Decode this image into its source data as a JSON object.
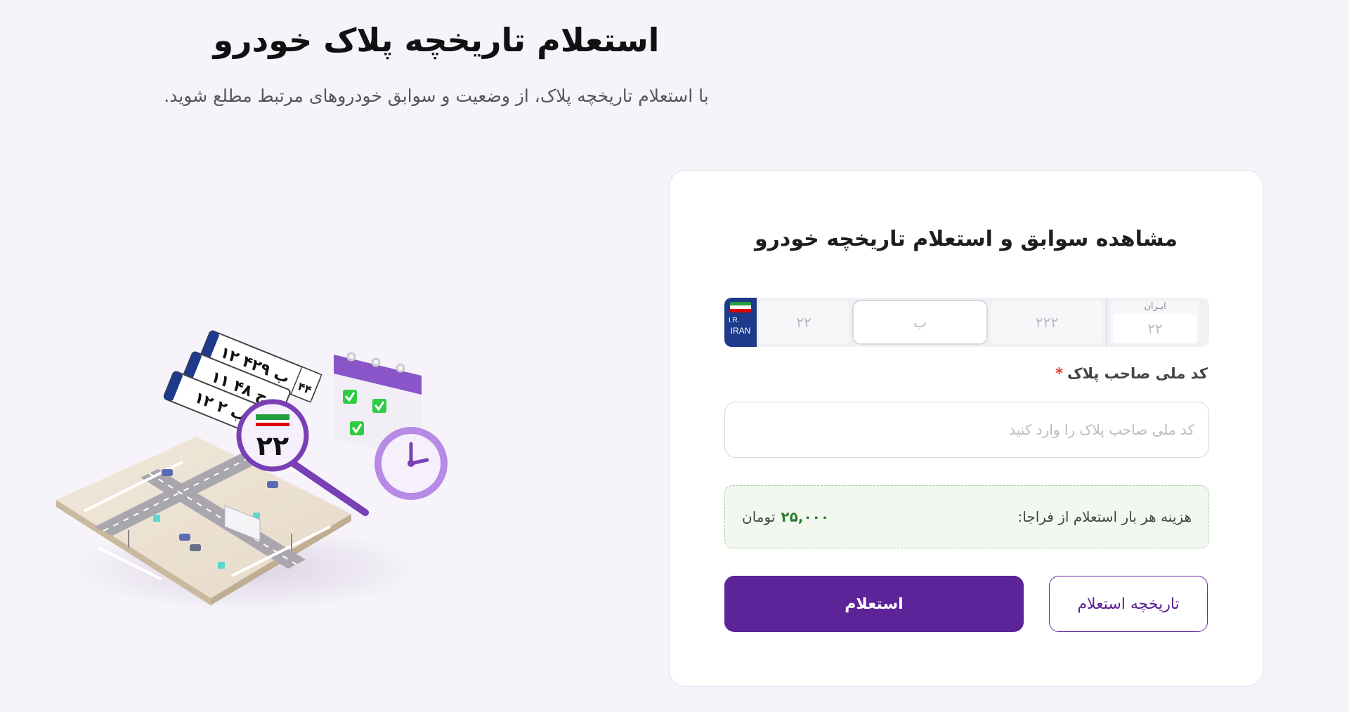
{
  "hero": {
    "title": "استعلام تاریخچه پلاک خودرو",
    "subtitle": "با استعلام تاریخچه پلاک، از وضعیت و سوابق خودروهای مرتبط مطلع شوید."
  },
  "form": {
    "title": "مشاهده سوابق و استعلام تاریخچه خودرو",
    "plate": {
      "country_ir": "I.R.",
      "country_iran": "IRAN",
      "two_digit_placeholder": "۲۲",
      "letter_placeholder": "ب",
      "three_digit_placeholder": "۲۲۲",
      "region_label": "ایـران",
      "region_placeholder": "۲۲"
    },
    "national_code": {
      "label": "کد ملی صاحب پلاک",
      "required_mark": "*",
      "placeholder": "کد ملی صاحب پلاک را وارد کنید",
      "value": ""
    },
    "price": {
      "label": "هزینه هر بار استعلام از فراجا:",
      "amount": "۲۵,۰۰۰",
      "currency": "تومان"
    },
    "buttons": {
      "history": "تاریخچه استعلام",
      "submit": "استعلام"
    }
  },
  "illustration": {
    "plates": [
      "۱۲ ب ۴۲۹",
      "۱۱ ج ۴۸",
      "۱۲ ب ۲"
    ],
    "plate_region": "۴۴",
    "magnified_number": "۲۲"
  },
  "colors": {
    "background": "#f6f3fa",
    "primary": "#5d2399",
    "price_green": "#2e7d32",
    "required": "#e53935"
  }
}
